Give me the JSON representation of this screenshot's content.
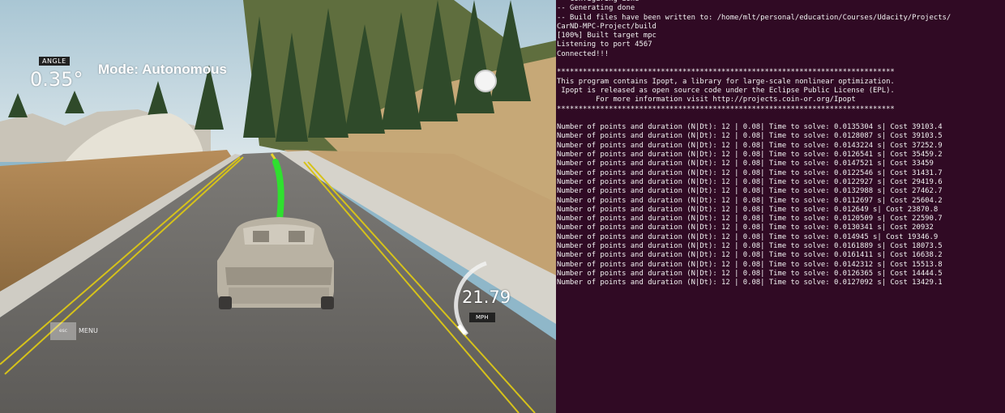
{
  "hud": {
    "angle_label": "ANGLE",
    "angle_value": "0.35°",
    "mode": "Mode: Autonomous",
    "speed": "21.79",
    "speed_unit": "MPH",
    "menu_key": "esc",
    "menu_label": "MENU"
  },
  "terminal": {
    "lines": [
      "-- Configuring done",
      "-- Generating done",
      "-- Build files have been written to: /home/mlt/personal/education/Courses/Udacity/Projects/",
      "CarND-MPC-Project/build",
      "[100%] Built target mpc",
      "Listening to port 4567",
      "Connected!!!",
      "",
      "******************************************************************************",
      "This program contains Ipopt, a library for large-scale nonlinear optimization.",
      " Ipopt is released as open source code under the Eclipse Public License (EPL).",
      "         For more information visit http://projects.coin-or.org/Ipopt",
      "******************************************************************************",
      "",
      "Number of points and duration (N|Dt): 12 | 0.08| Time to solve: 0.0135304 s| Cost 39103.4",
      "Number of points and duration (N|Dt): 12 | 0.08| Time to solve: 0.0128087 s| Cost 39103.5",
      "Number of points and duration (N|Dt): 12 | 0.08| Time to solve: 0.0143224 s| Cost 37252.9",
      "Number of points and duration (N|Dt): 12 | 0.08| Time to solve: 0.0126541 s| Cost 35459.2",
      "Number of points and duration (N|Dt): 12 | 0.08| Time to solve: 0.0147521 s| Cost 33459",
      "Number of points and duration (N|Dt): 12 | 0.08| Time to solve: 0.0122546 s| Cost 31431.7",
      "Number of points and duration (N|Dt): 12 | 0.08| Time to solve: 0.0122927 s| Cost 29419.6",
      "Number of points and duration (N|Dt): 12 | 0.08| Time to solve: 0.0132988 s| Cost 27462.7",
      "Number of points and duration (N|Dt): 12 | 0.08| Time to solve: 0.0112697 s| Cost 25604.2",
      "Number of points and duration (N|Dt): 12 | 0.08| Time to solve: 0.012649 s| Cost 23870.8",
      "Number of points and duration (N|Dt): 12 | 0.08| Time to solve: 0.0120509 s| Cost 22590.7",
      "Number of points and duration (N|Dt): 12 | 0.08| Time to solve: 0.0130341 s| Cost 20932",
      "Number of points and duration (N|Dt): 12 | 0.08| Time to solve: 0.014945 s| Cost 19346.9",
      "Number of points and duration (N|Dt): 12 | 0.08| Time to solve: 0.0161889 s| Cost 18073.5",
      "Number of points and duration (N|Dt): 12 | 0.08| Time to solve: 0.0161411 s| Cost 16638.2",
      "Number of points and duration (N|Dt): 12 | 0.08| Time to solve: 0.0142312 s| Cost 15513.8",
      "Number of points and duration (N|Dt): 12 | 0.08| Time to solve: 0.0126365 s| Cost 14444.5",
      "Number of points and duration (N|Dt): 12 | 0.08| Time to solve: 0.0127092 s| Cost 13429.1"
    ]
  },
  "colors": {
    "terminal_bg": "#300a24",
    "terminal_text": "#f2f2f2",
    "trajectory": "#2fe02f",
    "lane_line": "#d6c21a"
  }
}
